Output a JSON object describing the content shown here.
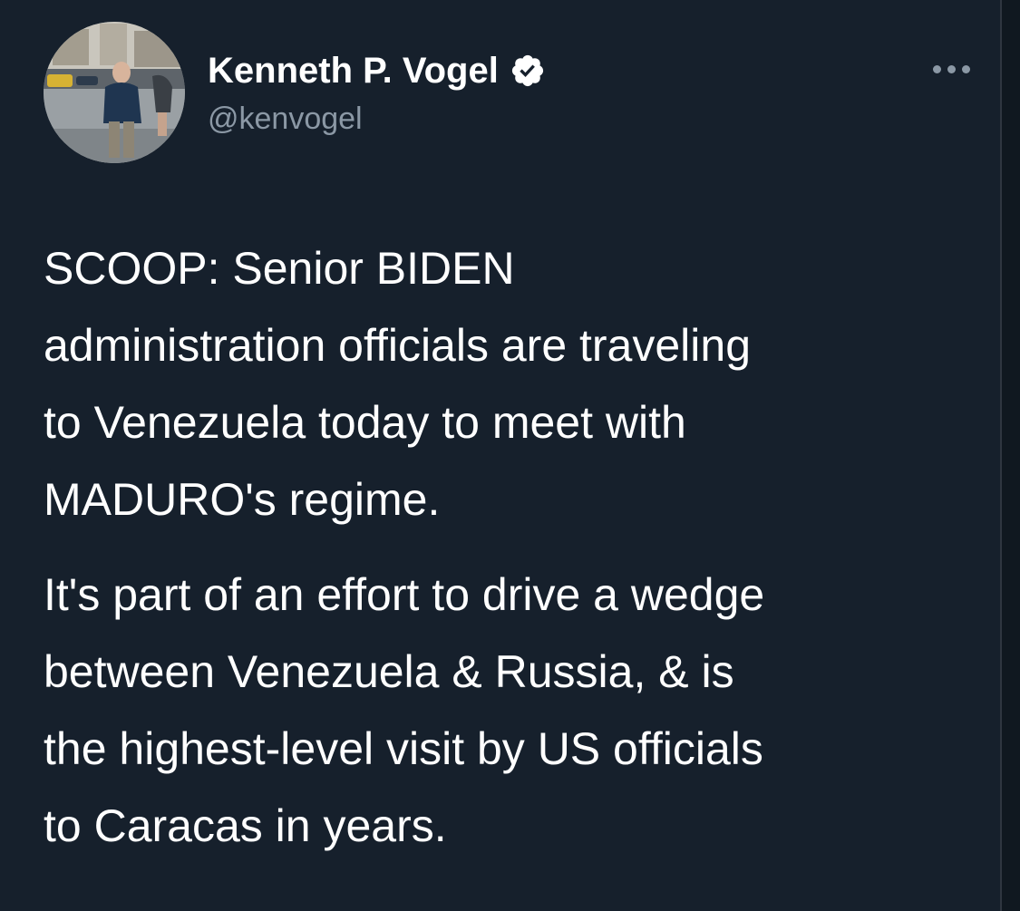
{
  "tweet": {
    "author": {
      "display_name": "Kenneth P. Vogel",
      "handle": "@kenvogel",
      "verified": true,
      "avatar_icon": "profile-photo"
    },
    "more_icon": "ellipsis-icon",
    "paragraphs": [
      "SCOOP: Senior BIDEN\nadministration officials are traveling\nto Venezuela today to meet with\nMADURO's regime.",
      "It's part of an effort to drive a wedge\nbetween Venezuela & Russia, & is\nthe highest-level visit by US officials\nto Caracas in years."
    ]
  },
  "colors": {
    "background": "#16202c",
    "text": "#ffffff",
    "secondary_text": "#8b98a5",
    "verified_badge": "#ffffff"
  }
}
